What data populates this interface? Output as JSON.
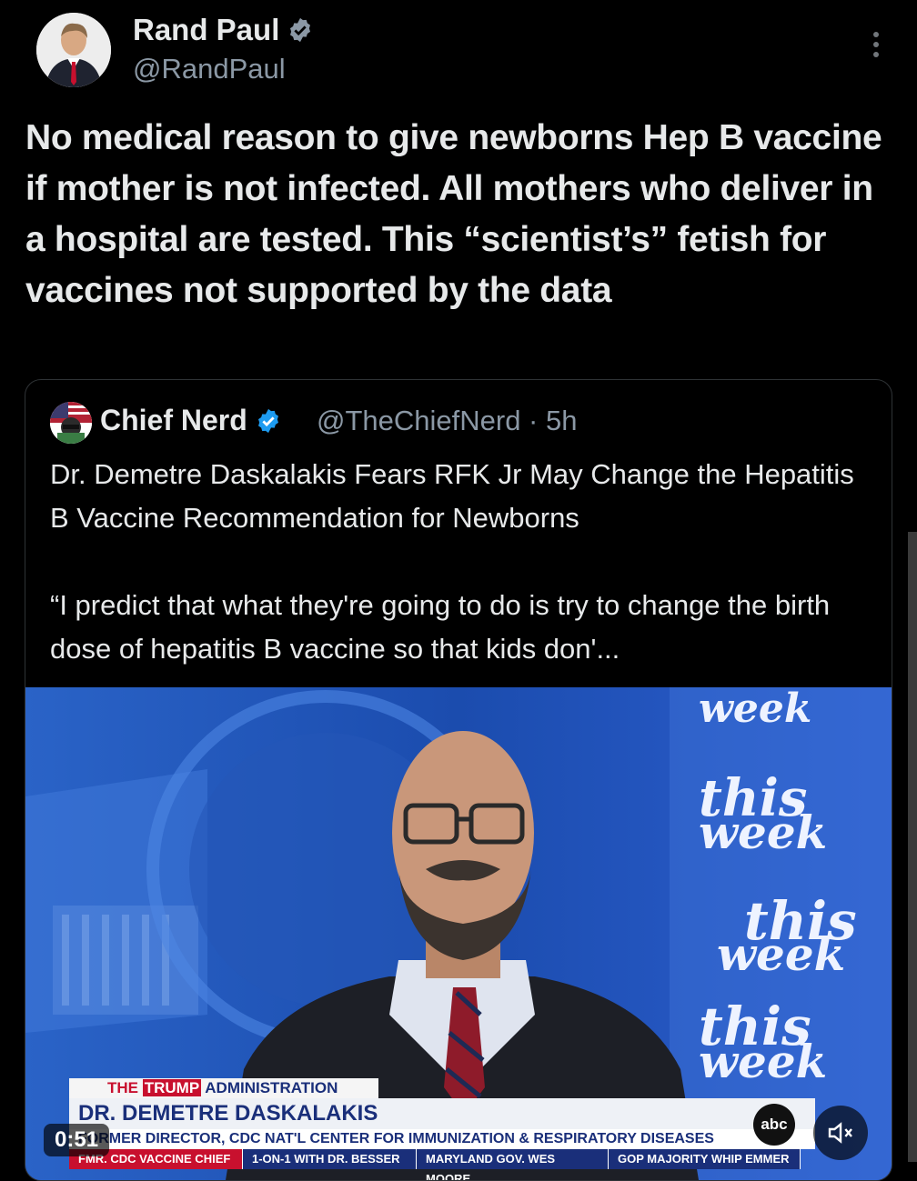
{
  "post": {
    "author_name": "Rand Paul",
    "author_handle": "@RandPaul",
    "text": "No medical reason to give newborns Hep B vaccine if mother is not infected. All mothers who deliver in a hospital are tested. This “scientist’s” fetish for vaccines not supported by the data"
  },
  "quoted": {
    "author_name": "Chief Nerd",
    "author_handle": "@TheChiefNerd · 5h",
    "headline": "Dr. Demetre Daskalakis Fears RFK Jr May Change the Hepatitis B Vaccine Recommendation for Newborns",
    "quote": "“I predict that what they're going to do is try to change the birth dose of hepatitis B vaccine so that kids don'..."
  },
  "video": {
    "duration": "0:51",
    "brand_lines": [
      "week",
      "this",
      "week",
      "this",
      "week",
      "this",
      "week"
    ],
    "abc_label": "abc",
    "chyron": {
      "topic_prefix": "THE",
      "topic_highlight": "TRUMP",
      "topic_rest": "ADMINISTRATION",
      "name": "DR. DEMETRE DASKALAKIS",
      "title": "FORMER DIRECTOR, CDC NAT'L CENTER FOR IMMUNIZATION & RESPIRATORY DISEASES",
      "ticker": [
        "FMR. CDC VACCINE CHIEF",
        "1-ON-1 WITH DR. BESSER",
        "MARYLAND GOV. WES MOORE",
        "GOP MAJORITY WHIP EMMER"
      ]
    }
  },
  "icons": [
    "verified-badge-icon",
    "more-options-icon",
    "mute-icon"
  ],
  "colors": {
    "verified": "#1d9bf0",
    "video_bg": "#1c4fae",
    "chyron_blue": "#1a2f7a",
    "ticker_red": "#c8102e"
  }
}
